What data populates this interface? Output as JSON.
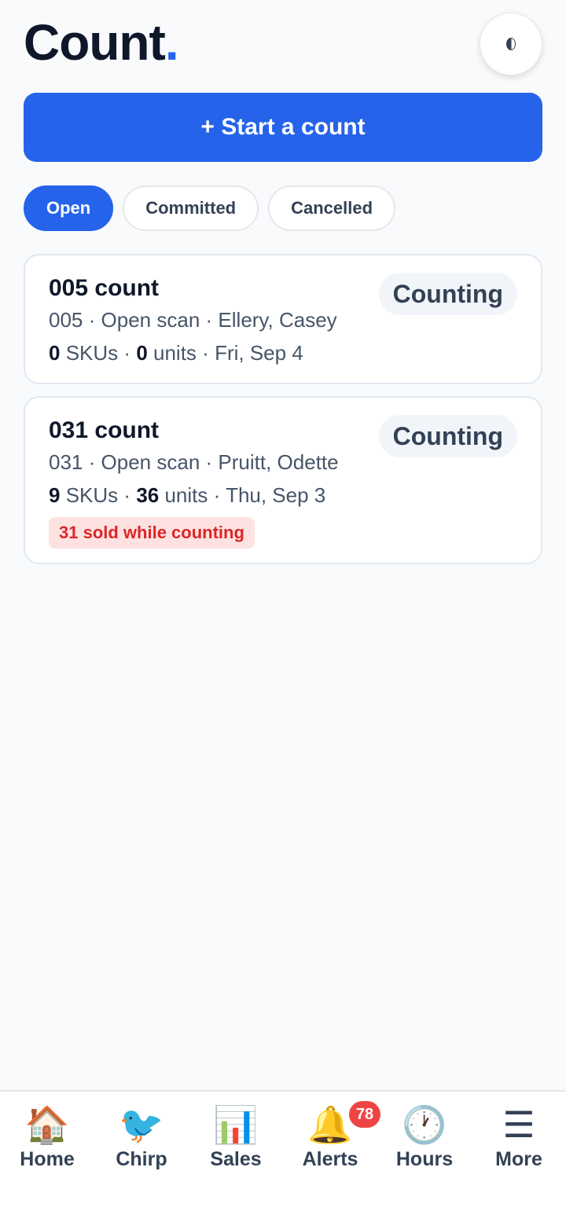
{
  "header": {
    "title": "Count",
    "title_dot": "."
  },
  "theme_toggle": {
    "icon": "half-moon-icon"
  },
  "start_button": {
    "label": "+ Start a count"
  },
  "filters": [
    {
      "label": "Open",
      "active": true
    },
    {
      "label": "Committed",
      "active": false
    },
    {
      "label": "Cancelled",
      "active": false
    }
  ],
  "counts": [
    {
      "title": "005 count",
      "code": "005",
      "scan_type": "Open scan",
      "people": "Ellery, Casey",
      "skus": "0",
      "skus_label": "SKUs",
      "units": "0",
      "units_label": "units",
      "date": "Fri, Sep 4",
      "status": "Counting",
      "warning": ""
    },
    {
      "title": "031 count",
      "code": "031",
      "scan_type": "Open scan",
      "people": "Pruitt, Odette",
      "skus": "9",
      "skus_label": "SKUs",
      "units": "36",
      "units_label": "units",
      "date": "Thu, Sep 3",
      "status": "Counting",
      "warning": "31 sold while counting"
    }
  ],
  "separator": "·",
  "nav": [
    {
      "icon": "🏠",
      "icon_name": "home-icon",
      "label": "Home",
      "badge": ""
    },
    {
      "icon": "🐦",
      "icon_name": "bird-icon",
      "label": "Chirp",
      "badge": ""
    },
    {
      "icon": "📊",
      "icon_name": "bar-chart-icon",
      "label": "Sales",
      "badge": ""
    },
    {
      "icon": "🔔",
      "icon_name": "bell-icon",
      "label": "Alerts",
      "badge": "78"
    },
    {
      "icon": "🕐",
      "icon_name": "clock-icon",
      "label": "Hours",
      "badge": ""
    },
    {
      "icon": "☰",
      "icon_name": "menu-icon",
      "label": "More",
      "badge": ""
    }
  ],
  "colors": {
    "accent": "#2563eb",
    "warning_text": "#dc2626",
    "warning_bg": "#fee2e2",
    "badge": "#ef4444"
  }
}
